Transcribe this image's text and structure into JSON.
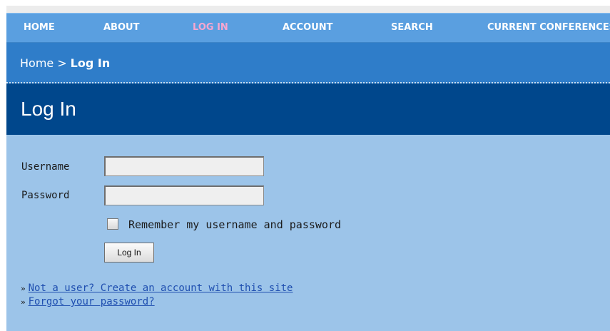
{
  "nav": {
    "items": [
      {
        "label": "HOME"
      },
      {
        "label": "ABOUT"
      },
      {
        "label": "LOG IN",
        "active": true
      },
      {
        "label": "ACCOUNT"
      },
      {
        "label": "SEARCH"
      },
      {
        "label": "CURRENT CONFERENCES"
      }
    ]
  },
  "breadcrumb": {
    "home": "Home",
    "separator": ">",
    "current": "Log In"
  },
  "page_title": "Log In",
  "form": {
    "username_label": "Username",
    "username_value": "",
    "password_label": "Password",
    "password_value": "",
    "remember_label": "Remember my username and password",
    "remember_checked": false,
    "submit_label": "Log In"
  },
  "links": {
    "bullet": "»",
    "create_account": "Not a user? Create an account with this site",
    "forgot_password": "Forgot your password?"
  },
  "colors": {
    "nav_bg": "#5a9fe0",
    "nav_active": "#f7a6d0",
    "breadcrumb_bg": "#2f7dc9",
    "title_bg": "#00478c",
    "content_bg": "#9cc4e9",
    "link": "#1f4fb0"
  }
}
